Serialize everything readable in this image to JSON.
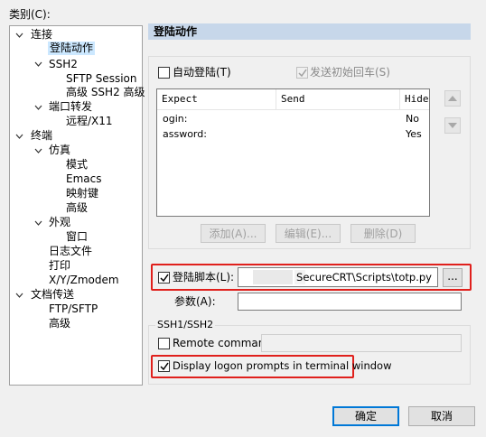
{
  "category_label": "类别(C):",
  "tree": {
    "connection": "连接",
    "logon_actions": "登陆动作",
    "ssh2": "SSH2",
    "sftp_session": "SFTP Session",
    "advanced_ssh2": "高级 SSH2 高级",
    "port_forwarding": "端口转发",
    "remote_x11": "远程/X11",
    "terminal": "终端",
    "emulation": "仿真",
    "modes": "模式",
    "emacs": "Emacs",
    "mapped_keys": "映射键",
    "advanced_emul": "高级",
    "appearance": "外观",
    "window": "窗口",
    "log_file": "日志文件",
    "printing": "打印",
    "xyz_modem": "X/Y/Zmodem",
    "file_transfer": "文档传送",
    "ftp_sftp": "FTP/SFTP",
    "advanced_ft": "高级"
  },
  "panel_title": "登陆动作",
  "auto_logon": {
    "label": "自动登陆(T)",
    "checked": false
  },
  "send_initial_cr": {
    "label": "发送初始回车(S)",
    "checked": true,
    "disabled": true
  },
  "expect_table": {
    "columns": [
      "Expect",
      "Send",
      "Hide"
    ],
    "rows": [
      {
        "expect": "ogin:",
        "send": "",
        "hide": "No"
      },
      {
        "expect": "assword:",
        "send": "",
        "hide": "Yes"
      }
    ]
  },
  "buttons": {
    "add": "添加(A)...",
    "edit": "编辑(E)...",
    "delete": "删除(D)",
    "browse": "...",
    "ok": "确定",
    "cancel": "取消"
  },
  "logon_script": {
    "label": "登陆脚本(L):",
    "checked": true,
    "path": "SecureCRT\\Scripts\\totp.py"
  },
  "arguments": {
    "label": "参数(A):",
    "value": ""
  },
  "ssh_group": {
    "title": "SSH1/SSH2"
  },
  "remote_command": {
    "label": "Remote command:",
    "checked": false,
    "value": ""
  },
  "display_prompts": {
    "label": "Display logon prompts in terminal window",
    "checked": true
  },
  "colors": {
    "highlight": "#e0201c",
    "panel_header": "#c7d7ea",
    "selection": "#cce8ff",
    "default_button": "#0078d7"
  }
}
